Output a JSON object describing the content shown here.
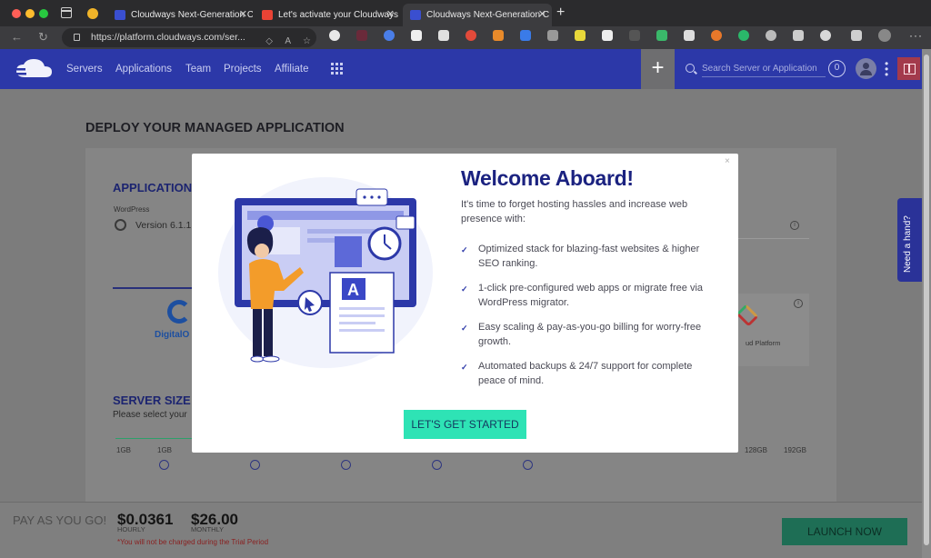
{
  "browser": {
    "tabs": [
      {
        "title": "Cloudways Next-Generation C",
        "active": false,
        "favicon_color": "#3a4fd0"
      },
      {
        "title": "Let's activate your Cloudways",
        "active": false,
        "favicon_color": "#ea4335"
      },
      {
        "title": "Cloudways Next-Generation C",
        "active": true,
        "favicon_color": "#3a4fd0"
      }
    ],
    "url": "https://platform.cloudways.com/ser..."
  },
  "header": {
    "nav": [
      "Servers",
      "Applications",
      "Team",
      "Projects",
      "Affiliate"
    ],
    "add_label": "+",
    "search_placeholder": "Search Server or Application",
    "notification_count": "0",
    "brand_color": "#2c38a8"
  },
  "page": {
    "title": "DEPLOY YOUR MANAGED APPLICATION",
    "application_heading": "APPLICATION",
    "app_label": "WordPress",
    "app_version": "Version 6.1.1",
    "provider_do": "DigitalO",
    "provider_gcp": "ud Platform",
    "server_size_heading": "SERVER SIZE",
    "server_size_hint": "Please select your",
    "sizes_left": [
      "1GB",
      "1GB"
    ],
    "sizes_right": [
      "128GB",
      "192GB"
    ]
  },
  "footer": {
    "payg_label": "PAY AS YOU GO!",
    "hourly_price": "$0.0361",
    "hourly_label": "HOURLY",
    "monthly_price": "$26.00",
    "monthly_label": "MONTHLY",
    "trial_note": "*You will not be charged during the Trial Period",
    "launch_label": "LAUNCH NOW"
  },
  "help_tab": "Need a hand?",
  "modal": {
    "close": "×",
    "title": "Welcome Aboard!",
    "intro": "It's time to forget hosting hassles and increase web presence with:",
    "features": [
      "Optimized stack for blazing-fast websites & higher SEO ranking.",
      "1-click pre-configured web apps or migrate free via WordPress migrator.",
      "Easy scaling & pay-as-you-go billing for worry-free growth.",
      "Automated backups & 24/7 support for complete peace of mind."
    ],
    "cta": "LET'S GET STARTED",
    "cta_color": "#2ee3b5",
    "illustration_letter": "A"
  }
}
